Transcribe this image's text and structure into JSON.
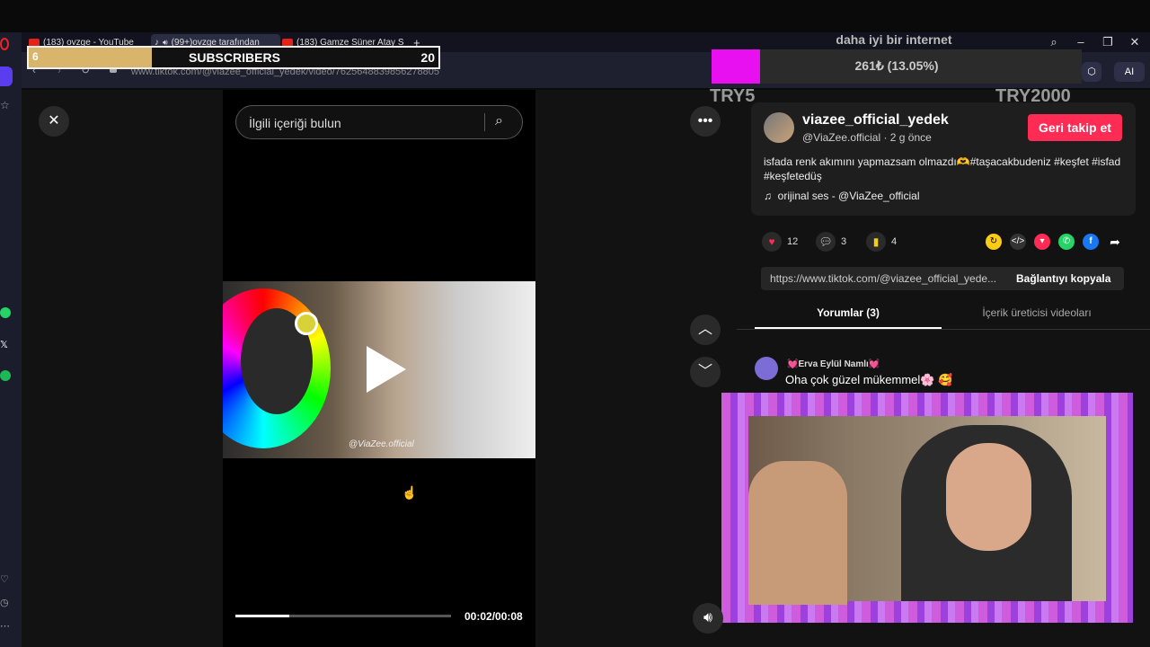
{
  "browser": {
    "tabs": [
      {
        "label": "(183) ovzge - YouTube",
        "type": "youtube"
      },
      {
        "label": "(99+)ovzge tarafından",
        "type": "tiktok"
      },
      {
        "label": "(183) Gamze Süner Atay S",
        "type": "youtube"
      }
    ],
    "new_tab": "+",
    "url": "www.tiktok.com/@viazee_official_yedek/video/7625648839856278805",
    "ai_label": "AI"
  },
  "subscribers_overlay": {
    "current": "6",
    "label": "SUBSCRIBERS",
    "goal": "20",
    "progress": 0.3
  },
  "donation_overlay": {
    "title": "daha iyi bir internet",
    "amount": "261₺ (13.05%)",
    "start": "TRY5",
    "goal": "TRY2000",
    "progress": 0.1305,
    "fill_color": "#e80ff0"
  },
  "video": {
    "search_placeholder": "İlgili içeriği bulun",
    "watermark": "@ViaZee.official",
    "time": "00:02/00:08",
    "progress": 0.25
  },
  "post": {
    "username": "viazee_official_yedek",
    "handle": "@ViaZee.official · 2 g önce",
    "follow_label": "Geri takip et",
    "description": "isfada renk akımını yapmazsam olmazdı🫶#taşacakbudeniz #keşfet #isfad #keşfetedüş",
    "music": "orijinal ses - @ViaZee_official",
    "likes": "12",
    "comments": "3",
    "saves": "4",
    "link_url": "https://www.tiktok.com/@viazee_official_yede...",
    "copy_link_label": "Bağlantıyı kopyala",
    "tab_comments": "Yorumlar (3)",
    "tab_creator_videos": "İçerik üreticisi videoları"
  },
  "comment": {
    "author": "💓Erva Eylül Namlı💓",
    "text": "Oha çok güzel mükemmel🌸 🥰"
  },
  "colors": {
    "follow_button": "#fe2c55",
    "subscribers_fill": "#d8b56a"
  }
}
